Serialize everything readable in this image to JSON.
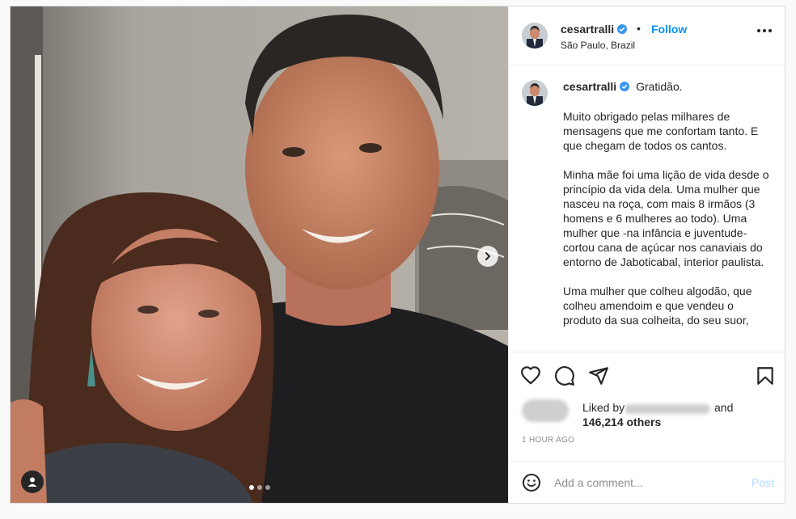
{
  "post": {
    "author": {
      "username": "cesartralli",
      "verified": true,
      "follow_label": "Follow",
      "separator": "•",
      "location": "São Paulo, Brazil"
    },
    "media": {
      "slide_count": 3,
      "active_slide": 1
    },
    "caption": {
      "username": "cesartralli",
      "first_line": "Gratidão.",
      "paragraphs": [
        "Muito obrigado pelas milhares de mensagens que me confortam tanto. E que chegam de todos os cantos.",
        "Minha mãe foi uma lição de vida desde o princípio da vida dela. Uma mulher que nasceu na roça, com mais 8 irmãos (3 homens e 6 mulheres ao todo). Uma mulher que -na infância e juventude- cortou cana de açúcar nos canaviais do entorno de Jaboticabal, interior paulista.",
        "Uma mulher que colheu algodão, que colheu amendoim e que vendeu o produto da sua colheita, do seu suor,"
      ]
    },
    "likes": {
      "liked_by_label": "Liked by",
      "and_label": "and",
      "others": "146,214 others"
    },
    "timestamp": "1 HOUR AGO",
    "comment_box": {
      "placeholder": "Add a comment...",
      "post_label": "Post"
    }
  },
  "colors": {
    "link_blue": "#0095f6",
    "post_disabled": "#b3dbff",
    "text": "#262626",
    "muted": "#8e8e8e",
    "border": "#dbdbdb"
  },
  "icons": [
    "heart-icon",
    "comment-icon",
    "share-icon",
    "bookmark-icon",
    "emoji-icon",
    "more-icon",
    "verified-icon",
    "chevron-right-icon",
    "user-tag-icon"
  ]
}
